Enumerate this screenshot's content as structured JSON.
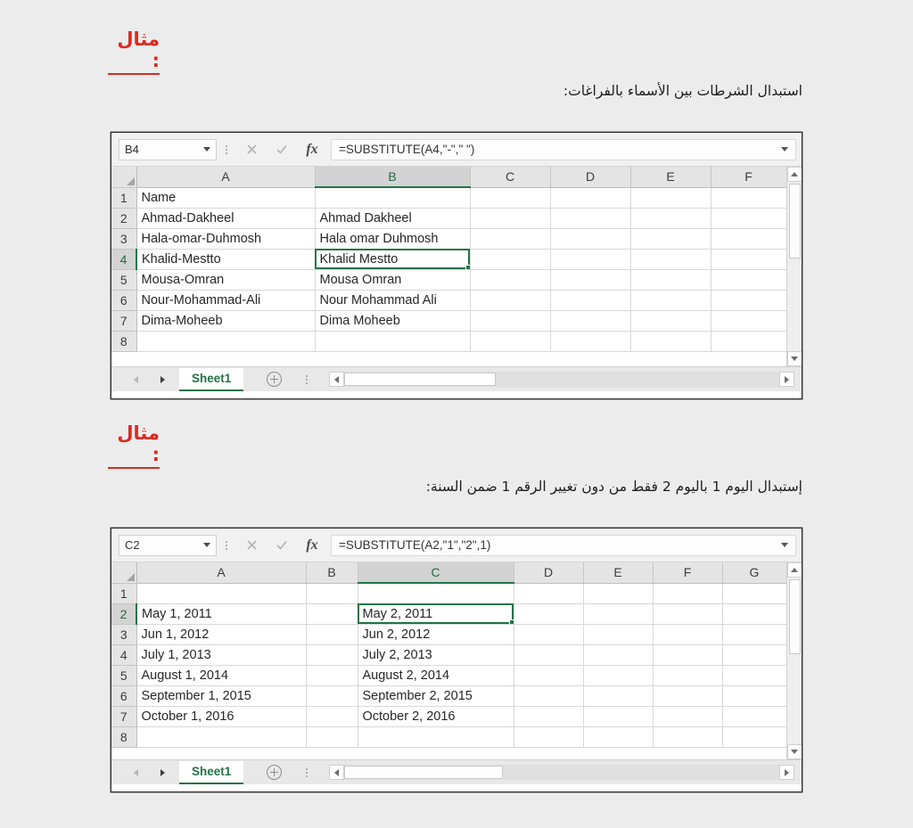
{
  "sections": [
    {
      "heading": "مثال :",
      "description": "استبدال الشرطات بين الأسماء بالفراغات:",
      "workbook": {
        "name_box": "B4",
        "formula": "=SUBSTITUTE(A4,\"-\",\" \")",
        "cancel_icon": "cancel-icon",
        "confirm_icon": "confirm-icon",
        "fx_label": "fx",
        "columns": [
          "A",
          "B",
          "C",
          "D",
          "E",
          "F"
        ],
        "selected_column": "B",
        "selected_row": "4",
        "selected_cell": "B4",
        "rows": [
          {
            "num": "1",
            "cells": [
              "Name",
              "",
              "",
              "",
              "",
              ""
            ]
          },
          {
            "num": "2",
            "cells": [
              "Ahmad-Dakheel",
              "Ahmad Dakheel",
              "",
              "",
              "",
              ""
            ]
          },
          {
            "num": "3",
            "cells": [
              "Hala-omar-Duhmosh",
              "Hala omar Duhmosh",
              "",
              "",
              "",
              ""
            ]
          },
          {
            "num": "4",
            "cells": [
              "Khalid-Mestto",
              "Khalid Mestto",
              "",
              "",
              "",
              ""
            ]
          },
          {
            "num": "5",
            "cells": [
              "Mousa-Omran",
              "Mousa Omran",
              "",
              "",
              "",
              ""
            ]
          },
          {
            "num": "6",
            "cells": [
              "Nour-Mohammad-Ali",
              "Nour Mohammad Ali",
              "",
              "",
              "",
              ""
            ]
          },
          {
            "num": "7",
            "cells": [
              "Dima-Moheeb",
              "Dima Moheeb",
              "",
              "",
              "",
              ""
            ]
          },
          {
            "num": "8",
            "cells": [
              "",
              "",
              "",
              "",
              "",
              ""
            ]
          }
        ],
        "sheet_tab": "Sheet1",
        "add_sheet_label": "add-sheet-button"
      }
    },
    {
      "heading": "مثال :",
      "description": "إستبدال اليوم 1 باليوم 2 فقط من دون تغيير الرقم 1 ضمن السنة:",
      "workbook": {
        "name_box": "C2",
        "formula": "=SUBSTITUTE(A2,\"1\",\"2\",1)",
        "cancel_icon": "cancel-icon",
        "confirm_icon": "confirm-icon",
        "fx_label": "fx",
        "columns": [
          "A",
          "B",
          "C",
          "D",
          "E",
          "F",
          "G"
        ],
        "selected_column": "C",
        "selected_row": "2",
        "selected_cell": "C2",
        "rows": [
          {
            "num": "1",
            "cells": [
              "",
              "",
              "",
              "",
              "",
              "",
              ""
            ]
          },
          {
            "num": "2",
            "cells": [
              "May 1, 2011",
              "",
              "May 2, 2011",
              "",
              "",
              "",
              ""
            ]
          },
          {
            "num": "3",
            "cells": [
              "Jun 1, 2012",
              "",
              "Jun 2, 2012",
              "",
              "",
              "",
              ""
            ]
          },
          {
            "num": "4",
            "cells": [
              "July 1, 2013",
              "",
              "July 2, 2013",
              "",
              "",
              "",
              ""
            ]
          },
          {
            "num": "5",
            "cells": [
              "August 1, 2014",
              "",
              "August 2, 2014",
              "",
              "",
              "",
              ""
            ]
          },
          {
            "num": "6",
            "cells": [
              "September 1, 2015",
              "",
              "September 2, 2015",
              "",
              "",
              "",
              ""
            ]
          },
          {
            "num": "7",
            "cells": [
              "October 1, 2016",
              "",
              "October 2, 2016",
              "",
              "",
              "",
              ""
            ]
          },
          {
            "num": "8",
            "cells": [
              "",
              "",
              "",
              "",
              "",
              "",
              ""
            ]
          }
        ],
        "sheet_tab": "Sheet1",
        "add_sheet_label": "add-sheet-button"
      }
    }
  ],
  "colors": {
    "page_background": "#ececed",
    "heading_red": "#d92b20",
    "excel_green": "#217346",
    "shaded_cell": "#d9d9d9"
  }
}
